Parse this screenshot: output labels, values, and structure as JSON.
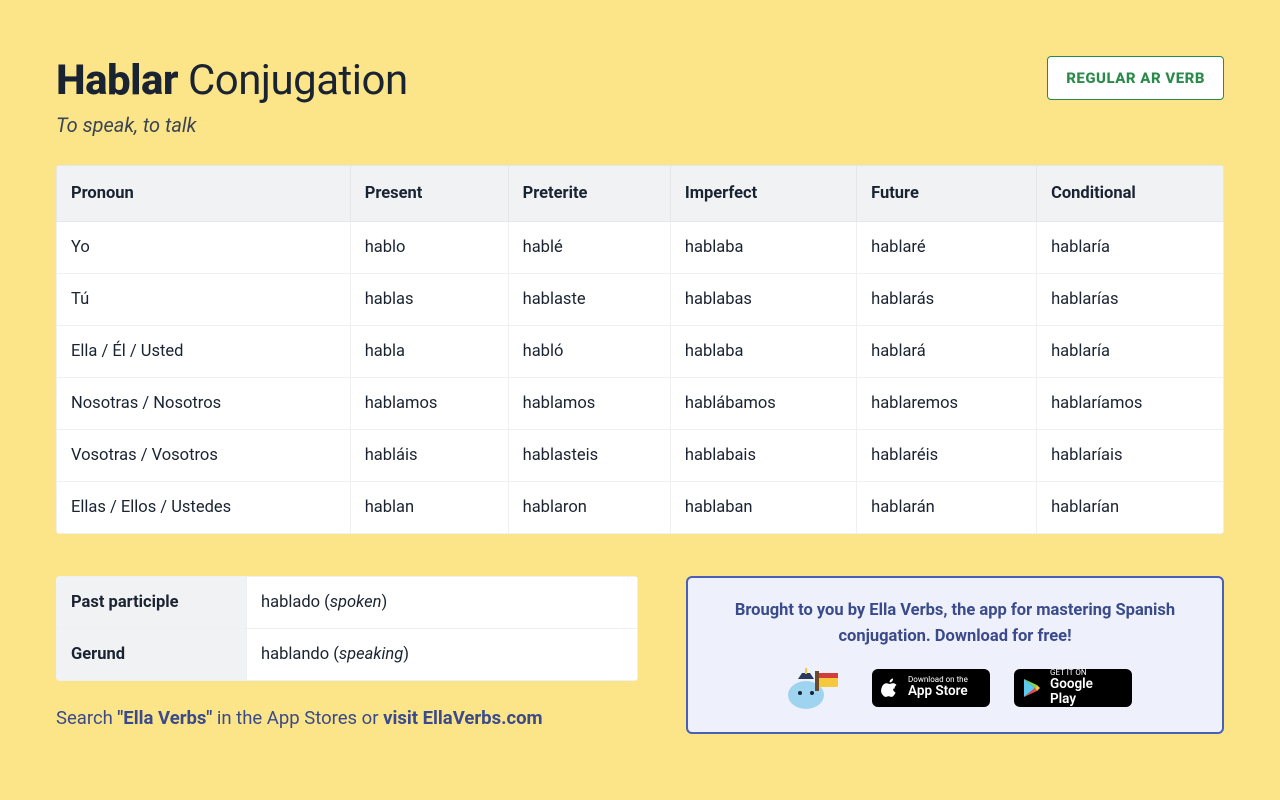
{
  "header": {
    "verb": "Hablar",
    "title_suffix": "Conjugation",
    "subtitle": "To speak, to talk",
    "badge": "REGULAR AR VERB"
  },
  "table": {
    "headers": [
      "Pronoun",
      "Present",
      "Preterite",
      "Imperfect",
      "Future",
      "Conditional"
    ],
    "rows": [
      [
        "Yo",
        "hablo",
        "hablé",
        "hablaba",
        "hablaré",
        "hablaría"
      ],
      [
        "Tú",
        "hablas",
        "hablaste",
        "hablabas",
        "hablarás",
        "hablarías"
      ],
      [
        "Ella / Él / Usted",
        "habla",
        "habló",
        "hablaba",
        "hablará",
        "hablaría"
      ],
      [
        "Nosotras / Nosotros",
        "hablamos",
        "hablamos",
        "hablábamos",
        "hablaremos",
        "hablaríamos"
      ],
      [
        "Vosotras / Vosotros",
        "habláis",
        "hablasteis",
        "hablabais",
        "hablaréis",
        "hablaríais"
      ],
      [
        "Ellas / Ellos / Ustedes",
        "hablan",
        "hablaron",
        "hablaban",
        "hablarán",
        "hablarían"
      ]
    ]
  },
  "forms": {
    "past_participle_label": "Past participle",
    "past_participle_value": "hablado",
    "past_participle_gloss": "spoken",
    "gerund_label": "Gerund",
    "gerund_value": "hablando",
    "gerund_gloss": "speaking"
  },
  "search_line": {
    "prefix": "Search ",
    "quoted": "\"Ella Verbs\"",
    "middle": " in the App Stores or ",
    "link": "visit EllaVerbs.com"
  },
  "promo": {
    "text": "Brought to you by Ella Verbs, the app for mastering Spanish conjugation. Download for free!",
    "app_store_small": "Download on the",
    "app_store_big": "App Store",
    "play_small": "GET IT ON",
    "play_big": "Google Play"
  }
}
